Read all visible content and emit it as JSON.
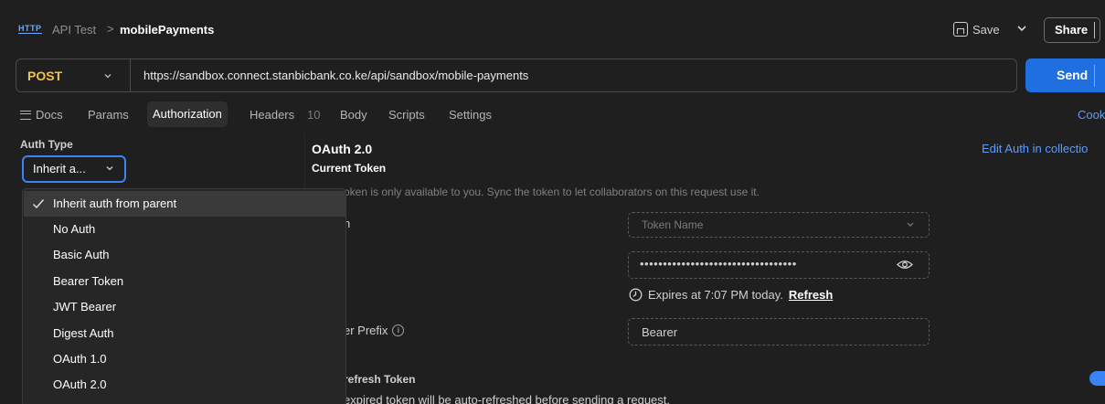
{
  "header": {
    "http_icon": "HTTP",
    "breadcrumb_parent": "API Test",
    "breadcrumb_sep": ">",
    "breadcrumb_current": "mobilePayments",
    "save_label": "Save",
    "share_label": "Share"
  },
  "request": {
    "method": "POST",
    "url": "https://sandbox.connect.stanbicbank.co.ke/api/sandbox/mobile-payments",
    "send_label": "Send"
  },
  "tabs": {
    "docs": "Docs",
    "params": "Params",
    "authorization": "Authorization",
    "headers": "Headers",
    "headers_count": "10",
    "body": "Body",
    "scripts": "Scripts",
    "settings": "Settings",
    "cookies": "Cook"
  },
  "auth": {
    "type_label": "Auth Type",
    "selected": "Inherit a...",
    "options": [
      "Inherit auth from parent",
      "No Auth",
      "Basic Auth",
      "Bearer Token",
      "JWT Bearer",
      "Digest Auth",
      "OAuth 1.0",
      "OAuth 2.0"
    ]
  },
  "oauth": {
    "title": "OAuth 2.0",
    "current_token": "Current Token",
    "edit_link": "Edit Auth in collectio",
    "token_note": "oken is only available to you. Sync the token to let collaborators on this request use it.",
    "partial_label": "n",
    "token_name_placeholder": "Token Name",
    "token_masked": "••••••••••••••••••••••••••••••••••",
    "expires_text": "Expires at 7:07 PM today.",
    "refresh_label": "Refresh",
    "prefix_label": "er Prefix",
    "prefix_value": "Bearer",
    "refresh_token_label": "refresh Token",
    "refresh_note": "expired token will be auto-refreshed before sending a request."
  },
  "colors": {
    "accent": "#1f6fe0",
    "method": "#f5c542",
    "link": "#5e9df5",
    "background": "#1f1f1f"
  }
}
